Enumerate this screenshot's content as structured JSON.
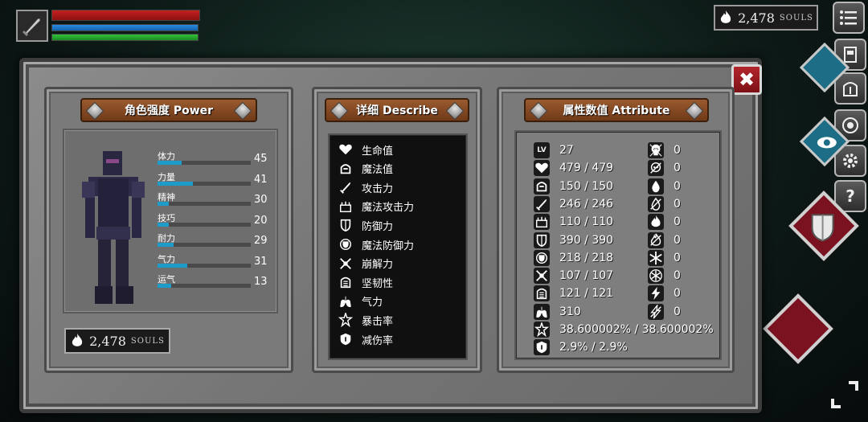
{
  "hud": {
    "weapon_icon": "sword-icon",
    "hp_color": "#c42020",
    "mp_color": "#2a8be0",
    "stamina_color": "#32c23a",
    "souls_count": "2,478",
    "souls_unit": "SOULS"
  },
  "side_menu": {
    "buttons": [
      "menu-icon",
      "armor-icon",
      "helmet-icon",
      "ring-icon",
      "gear-icon",
      "help-icon"
    ],
    "help_glyph": "?"
  },
  "panel": {
    "close_glyph": "✖",
    "power": {
      "title": "角色强度 Power",
      "stats": [
        {
          "label": "体力",
          "value": "45",
          "fill": 0.26
        },
        {
          "label": "力量",
          "value": "41",
          "fill": 0.38
        },
        {
          "label": "精神",
          "value": "30",
          "fill": 0.12
        },
        {
          "label": "技巧",
          "value": "20",
          "fill": 0.12
        },
        {
          "label": "耐力",
          "value": "29",
          "fill": 0.17
        },
        {
          "label": "气力",
          "value": "31",
          "fill": 0.32
        },
        {
          "label": "运气",
          "value": "13",
          "fill": 0.15
        }
      ],
      "souls_count": "2,478",
      "souls_unit": "SOULS"
    },
    "describe": {
      "title": "详细 Describe",
      "items": [
        {
          "icon": "heart-icon",
          "label": "生命值"
        },
        {
          "icon": "mana-icon",
          "label": "魔法值"
        },
        {
          "icon": "sword-icon",
          "label": "攻击力"
        },
        {
          "icon": "magic-attack-icon",
          "label": "魔法攻击力"
        },
        {
          "icon": "shield-icon",
          "label": "防御力"
        },
        {
          "icon": "magic-shield-icon",
          "label": "魔法防御力"
        },
        {
          "icon": "break-icon",
          "label": "崩解力"
        },
        {
          "icon": "toughness-icon",
          "label": "坚韧性"
        },
        {
          "icon": "lungs-icon",
          "label": "气力"
        },
        {
          "icon": "crit-icon",
          "label": "暴击率"
        },
        {
          "icon": "damage-reduction-icon",
          "label": "减伤率"
        }
      ]
    },
    "attribute": {
      "title": "属性数值 Attribute",
      "lv_label": "LV",
      "left": [
        {
          "icon": "level-icon",
          "value": "27"
        },
        {
          "icon": "heart-icon",
          "value": "479 / 479"
        },
        {
          "icon": "mana-icon",
          "value": "150 / 150"
        },
        {
          "icon": "sword-icon",
          "value": "246 / 246"
        },
        {
          "icon": "magic-attack-icon",
          "value": "110 / 110"
        },
        {
          "icon": "shield-icon",
          "value": "390 / 390"
        },
        {
          "icon": "magic-shield-icon",
          "value": "218 / 218"
        },
        {
          "icon": "break-icon",
          "value": "107 / 107"
        },
        {
          "icon": "toughness-icon",
          "value": "121 / 121"
        },
        {
          "icon": "lungs-icon",
          "value": "310"
        },
        {
          "icon": "crit-icon",
          "value": "38.600002% / 38.600002%"
        },
        {
          "icon": "damage-reduction-icon",
          "value": "2.9% / 2.9%"
        }
      ],
      "right": [
        {
          "icon": "skull-icon",
          "value": "0"
        },
        {
          "icon": "poison-skull-icon",
          "value": "0"
        },
        {
          "icon": "drop-icon",
          "value": "0"
        },
        {
          "icon": "drop-resist-icon",
          "value": "0"
        },
        {
          "icon": "fire-icon",
          "value": "0"
        },
        {
          "icon": "fire-resist-icon",
          "value": "0"
        },
        {
          "icon": "frost-icon",
          "value": "0"
        },
        {
          "icon": "frost-resist-icon",
          "value": "0"
        },
        {
          "icon": "lightning-icon",
          "value": "0"
        },
        {
          "icon": "lightning-resist-icon",
          "value": "0"
        }
      ]
    }
  }
}
